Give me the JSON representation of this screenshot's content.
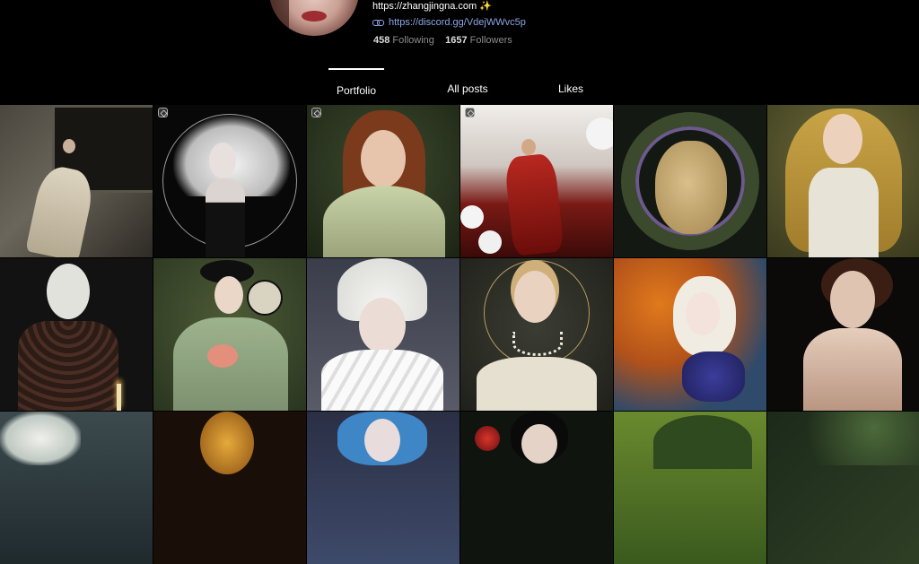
{
  "profile": {
    "website": "https://zhangjingna.com ✨",
    "discord": "https://discord.gg/VdejWWvc5p",
    "following_count": "458",
    "following_label": "Following",
    "followers_count": "1657",
    "followers_label": "Followers"
  },
  "tabs": [
    {
      "label": "Portfolio",
      "active": true
    },
    {
      "label": "All posts",
      "active": false
    },
    {
      "label": "Likes",
      "active": false
    }
  ],
  "gallery": {
    "items": [
      {
        "title": "woman seated in stone window",
        "badge": false
      },
      {
        "title": "woman with white hair in circle",
        "badge": true
      },
      {
        "title": "red-haired girl with flowers",
        "badge": true
      },
      {
        "title": "woman in red dress running",
        "badge": true
      },
      {
        "title": "nude figure in floral wreath",
        "badge": false
      },
      {
        "title": "woman with long golden hair",
        "badge": false
      },
      {
        "title": "pale woman with dark braided collar",
        "badge": false
      },
      {
        "title": "woman with fan in green hanfu",
        "badge": false
      },
      {
        "title": "woman with white petal headdress",
        "badge": false
      },
      {
        "title": "woman with pearl necklace and halo",
        "badge": false
      },
      {
        "title": "woman in orange flowers",
        "badge": false
      },
      {
        "title": "woman with bare back",
        "badge": false
      },
      {
        "title": "figure with white flowers underwater",
        "badge": false
      },
      {
        "title": "golden masked figure",
        "badge": false
      },
      {
        "title": "woman with blue hair",
        "badge": false
      },
      {
        "title": "woman with dark hair and flowers",
        "badge": false
      },
      {
        "title": "figure in green foliage",
        "badge": false
      },
      {
        "title": "dark green forest scene",
        "badge": false
      }
    ]
  }
}
